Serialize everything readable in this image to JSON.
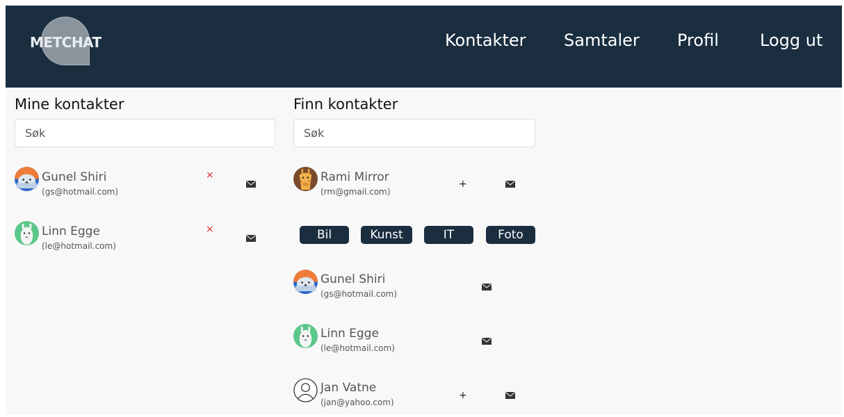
{
  "header": {
    "logo_text": "METCHAT",
    "nav": [
      "Kontakter",
      "Samtaler",
      "Profil",
      "Logg ut"
    ]
  },
  "my_contacts": {
    "title": "Mine kontakter",
    "search_placeholder": "Søk",
    "contacts": [
      {
        "name": "Gunel Shiri",
        "email": "(gs@hotmail.com)",
        "avatar": "seal-avatar",
        "remove": "×"
      },
      {
        "name": "Linn Egge",
        "email": "(le@hotmail.com)",
        "avatar": "llama-avatar",
        "remove": "×"
      }
    ]
  },
  "find_contacts": {
    "title": "Finn kontakter",
    "search_placeholder": "Søk",
    "suggested": {
      "name": "Rami Mirror",
      "email": "(rm@gmail.com)",
      "avatar": "giraffe-avatar",
      "add": "+"
    },
    "tags": [
      "Bil",
      "Kunst",
      "IT",
      "Foto"
    ],
    "results": [
      {
        "name": "Gunel Shiri",
        "email": "(gs@hotmail.com)",
        "avatar": "seal-avatar"
      },
      {
        "name": "Linn Egge",
        "email": "(le@hotmail.com)",
        "avatar": "llama-avatar"
      },
      {
        "name": "Jan Vatne",
        "email": "(jan@yahoo.com)",
        "avatar": "person-outline-icon",
        "add": "+"
      }
    ]
  },
  "colors": {
    "header_bg": "#1a2e40",
    "tag_bg": "#1a2e40",
    "remove": "#e02a2a",
    "page_bg": "#f8f8f8"
  },
  "icons": {
    "mail": "envelope-icon",
    "remove": "close-icon",
    "add": "plus-icon"
  }
}
